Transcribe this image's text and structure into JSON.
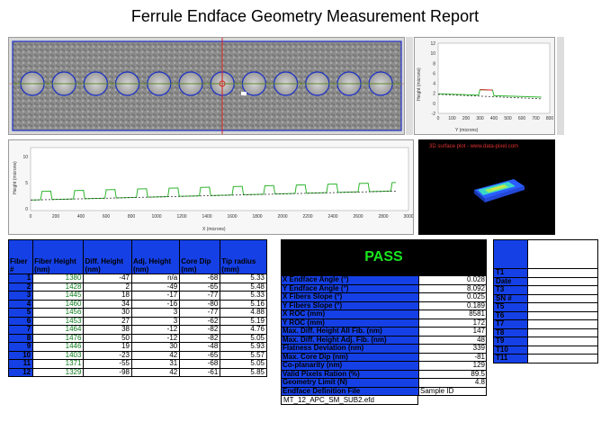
{
  "report": {
    "title": "Ferrule Endface Geometry Measurement Report"
  },
  "y_profile": {
    "xlabel": "Y (microns)",
    "ylabel": "Height (microns)",
    "x_ticks": [
      "0",
      "100",
      "200",
      "300",
      "400",
      "500",
      "600",
      "700",
      "800"
    ],
    "y_ticks": [
      "12",
      "10",
      "8",
      "6",
      "4",
      "2",
      "0",
      "-2"
    ]
  },
  "x_profile": {
    "xlabel": "X (microns)",
    "ylabel": "Height (microns)",
    "x_ticks": [
      "0",
      "200",
      "400",
      "600",
      "800",
      "1000",
      "1200",
      "1400",
      "1600",
      "1800",
      "2000",
      "2200",
      "2400",
      "2600",
      "2800",
      "3000"
    ],
    "y_ticks": [
      "10",
      "5",
      "0"
    ]
  },
  "surface_plot": {
    "caption": "3D surface plot - www.data-pixel.com"
  },
  "fiber_table": {
    "headers": [
      "Fiber #",
      "Fiber Height (nm)",
      "Diff. Height (nm)",
      "Adj. Height (nm)",
      "Core Dip (nm)",
      "Tip radius (mm)"
    ],
    "rows": [
      [
        "1",
        "1380",
        "-47",
        "n/a",
        "-68",
        "5.33"
      ],
      [
        "2",
        "1428",
        "2",
        "-49",
        "-65",
        "5.48"
      ],
      [
        "3",
        "1445",
        "18",
        "-17",
        "-77",
        "5.33"
      ],
      [
        "4",
        "1460",
        "34",
        "-16",
        "-80",
        "5.16"
      ],
      [
        "5",
        "1456",
        "30",
        "3",
        "-77",
        "4.88"
      ],
      [
        "6",
        "1453",
        "27",
        "3",
        "-62",
        "5.19"
      ],
      [
        "7",
        "1464",
        "38",
        "-12",
        "-82",
        "4.76"
      ],
      [
        "8",
        "1476",
        "50",
        "-12",
        "-82",
        "5.05"
      ],
      [
        "9",
        "1446",
        "19",
        "30",
        "-48",
        "5.93"
      ],
      [
        "10",
        "1403",
        "-23",
        "42",
        "-65",
        "5.57"
      ],
      [
        "11",
        "1371",
        "-55",
        "31",
        "-68",
        "5.05"
      ],
      [
        "12",
        "1329",
        "-98",
        "42",
        "-61",
        "5.85"
      ]
    ]
  },
  "result": {
    "status": "PASS",
    "rows": [
      [
        "X Endface Angle (°)",
        "0.028"
      ],
      [
        "Y Endface Angle (°)",
        "8.092"
      ],
      [
        "X Fibers Slope (°)",
        "0.025"
      ],
      [
        "Y Fibers Slope (°)",
        "0.189"
      ],
      [
        "X ROC (mm)",
        "8581"
      ],
      [
        "Y ROC (mm)",
        "172"
      ],
      [
        "Max. Diff. Height All Fib. (nm)",
        "147"
      ],
      [
        "Max. Diff. Height Adj. Fib. (nm)",
        "48"
      ],
      [
        "Flatness Deviation (nm)",
        "339"
      ],
      [
        "Max. Core Dip (nm)",
        "-81"
      ],
      [
        "Co-planarity (nm)",
        "129"
      ],
      [
        "Valid Pixels Ration (%)",
        "89.5"
      ],
      [
        "Geometry Limit (N)",
        "4.8"
      ],
      [
        "Endface Definition File",
        "Sample ID"
      ]
    ],
    "file_name": "MT_12_APC_SM_SUB2.efd"
  },
  "t_table": {
    "rows": [
      [
        "T1",
        ""
      ],
      [
        "Date",
        ""
      ],
      [
        "T3",
        ""
      ],
      [
        "SN #",
        ""
      ],
      [
        "T5",
        ""
      ],
      [
        "T6",
        ""
      ],
      [
        "T7",
        ""
      ],
      [
        "T8",
        ""
      ],
      [
        "T9",
        ""
      ],
      [
        "T10",
        ""
      ],
      [
        "T11",
        ""
      ]
    ]
  },
  "colors": {
    "header_blue": "#1540e6",
    "pass_green": "#19e61e",
    "profile_green": "#2db52d",
    "profile_red": "#d42020",
    "fiber_blue": "#1a2fc8"
  }
}
